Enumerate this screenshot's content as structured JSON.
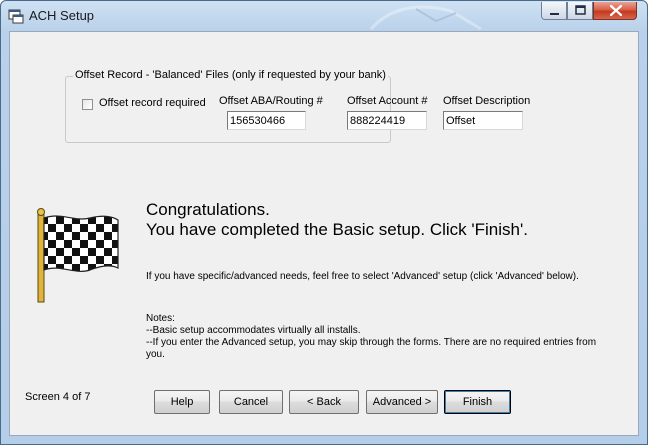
{
  "window": {
    "title": "ACH Setup",
    "controls": {
      "minimize": "minimize",
      "maximize": "maximize",
      "close": "close"
    }
  },
  "offset_group": {
    "legend": "Offset Record - 'Balanced' Files (only if requested by your bank)",
    "checkbox_label": "Offset record required",
    "checkbox_checked": false,
    "aba_label": "Offset ABA/Routing #",
    "aba_value": "156530466",
    "account_label": "Offset Account #",
    "account_value": "888224419",
    "description_label": "Offset Description",
    "description_value": "Offset"
  },
  "message": {
    "heading_line1": "Congratulations.",
    "heading_line2": "You have completed the Basic setup.  Click 'Finish'.",
    "advanced_text": "If you have specific/advanced needs, feel free to select 'Advanced' setup (click 'Advanced' below).",
    "notes_title": "Notes:",
    "note1": "--Basic setup accommodates virtually all installs.",
    "note2": "--If you enter the Advanced setup, you may skip through the forms.  There are no required entries from you."
  },
  "footer": {
    "screen_indicator": "Screen 4 of 7",
    "help_label": "Help",
    "cancel_label": "Cancel",
    "back_label": "< Back",
    "advanced_label": "Advanced >",
    "finish_label": "Finish"
  },
  "icons": {
    "flag": "checkered-flag-icon",
    "app": "app-icon"
  },
  "colors": {
    "close_button": "#c4391f",
    "titlebar": "#b9d1ea",
    "client_bg": "#f0f0f0"
  }
}
